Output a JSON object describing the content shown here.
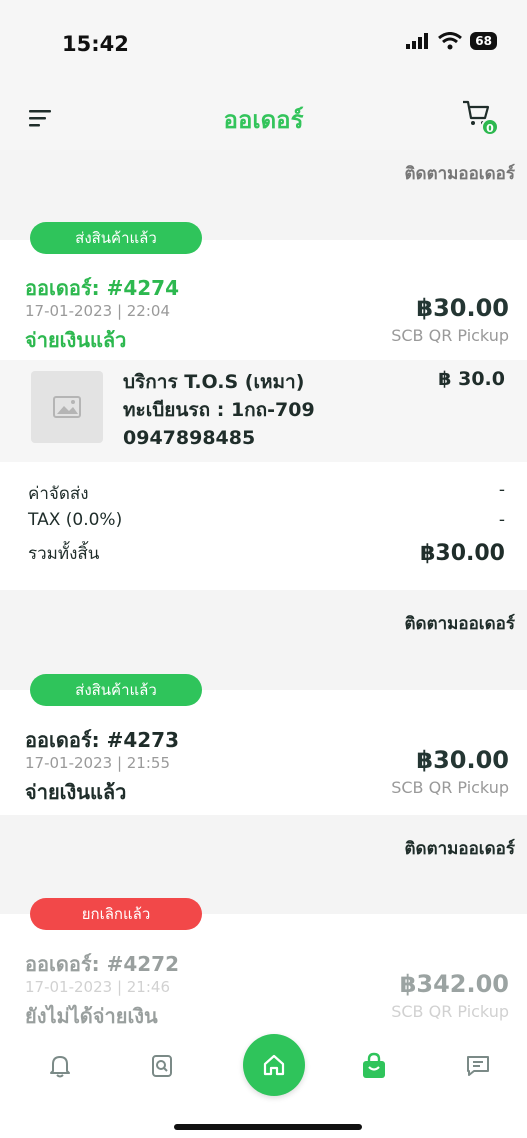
{
  "status_bar": {
    "time": "15:42",
    "battery": "68"
  },
  "header": {
    "title": "ออเดอร์",
    "cart_count": "0"
  },
  "track_label": "ติดตามออเดอร์",
  "orders": [
    {
      "badge": "ส่งสินค้าแล้ว",
      "number": "ออเดอร์: #4274",
      "datetime": "17-01-2023 | 22:04",
      "payment_status": "จ่ายเงินแล้ว",
      "total": "฿30.00",
      "method": "SCB QR Pickup",
      "item": {
        "line1": "บริการ T.O.S (เหมา)",
        "line2": "ทะเบียนรถ : 1กถ-709",
        "line3": "0947898485",
        "price": "฿ 30.0"
      },
      "summary": {
        "shipping_label": "ค่าจัดส่ง",
        "shipping_value": "-",
        "tax_label": "TAX (0.0%)",
        "tax_value": "-",
        "total_label": "รวมทั้งสิ้น",
        "total_value": "฿30.00"
      }
    },
    {
      "badge": "ส่งสินค้าแล้ว",
      "number": "ออเดอร์: #4273",
      "datetime": "17-01-2023 | 21:55",
      "payment_status": "จ่ายเงินแล้ว",
      "total": "฿30.00",
      "method": "SCB QR Pickup"
    },
    {
      "badge": "ยกเลิกแล้ว",
      "number": "ออเดอร์: #4272",
      "datetime": "17-01-2023 | 21:46",
      "payment_status": "ยังไม่ได้จ่ายเงิน",
      "total": "฿342.00",
      "method": "SCB QR Pickup"
    }
  ],
  "colors": {
    "accent": "#2fc45b",
    "cancel": "#f24849"
  },
  "tabs": [
    "bell-icon",
    "search-doc-icon",
    "home-icon",
    "shopping-bag-icon",
    "message-icon"
  ]
}
